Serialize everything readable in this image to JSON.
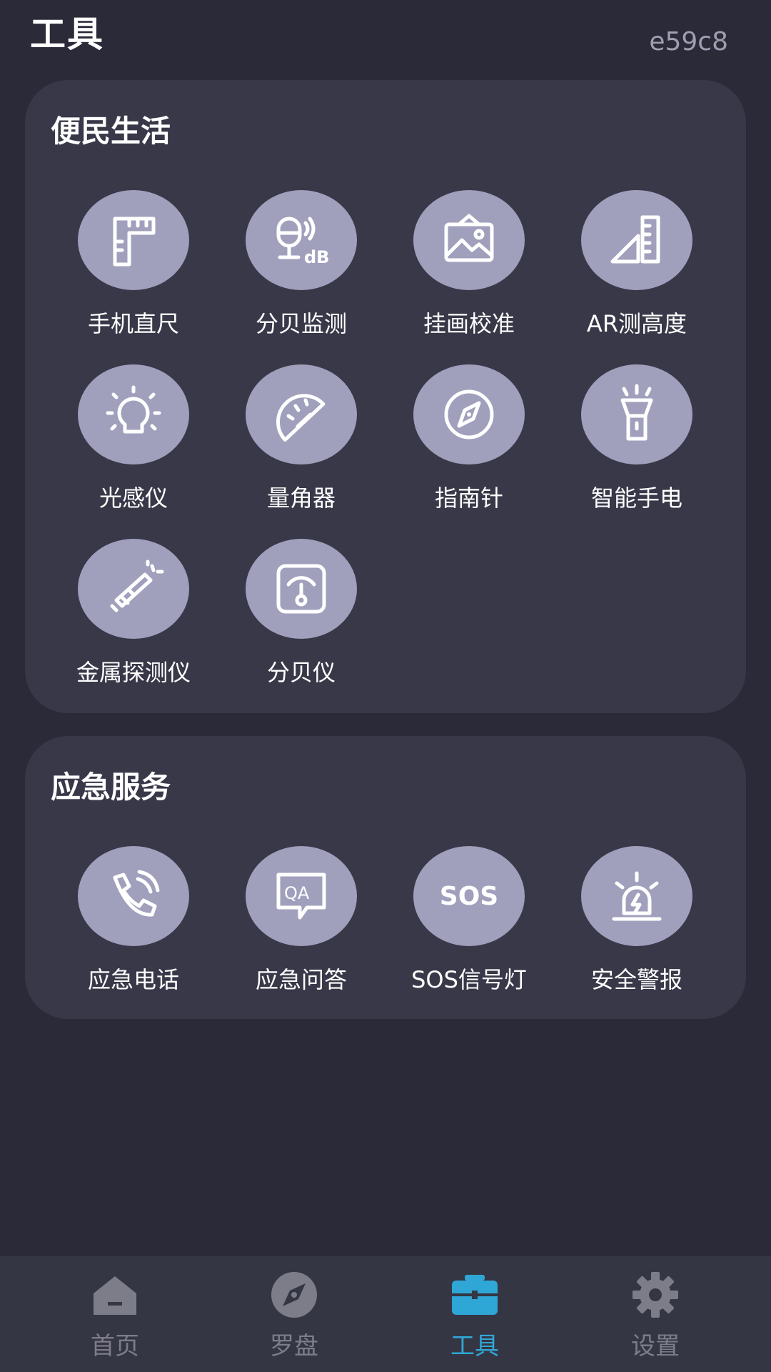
{
  "header": {
    "title": "工具",
    "code": "e59c8"
  },
  "sections": [
    {
      "title": "便民生活",
      "tools": [
        {
          "label": "手机直尺",
          "icon": "ruler-icon"
        },
        {
          "label": "分贝监测",
          "icon": "decibel-monitor-icon"
        },
        {
          "label": "挂画校准",
          "icon": "picture-frame-icon"
        },
        {
          "label": "AR测高度",
          "icon": "height-ruler-icon"
        },
        {
          "label": "光感仪",
          "icon": "light-bulb-icon"
        },
        {
          "label": "量角器",
          "icon": "protractor-icon"
        },
        {
          "label": "指南针",
          "icon": "compass-icon"
        },
        {
          "label": "智能手电",
          "icon": "flashlight-icon"
        },
        {
          "label": "金属探测仪",
          "icon": "metal-detector-icon"
        },
        {
          "label": "分贝仪",
          "icon": "sound-meter-icon"
        }
      ]
    },
    {
      "title": "应急服务",
      "tools": [
        {
          "label": "应急电话",
          "icon": "phone-call-icon"
        },
        {
          "label": "应急问答",
          "icon": "qa-bubble-icon"
        },
        {
          "label": "SOS信号灯",
          "icon": "sos-icon",
          "icon_text": "SOS"
        },
        {
          "label": "安全警报",
          "icon": "alarm-siren-icon"
        }
      ]
    }
  ],
  "nav": {
    "items": [
      {
        "label": "首页",
        "icon": "home-icon",
        "active": false
      },
      {
        "label": "罗盘",
        "icon": "compass-icon",
        "active": false
      },
      {
        "label": "工具",
        "icon": "toolbox-icon",
        "active": true
      },
      {
        "label": "设置",
        "icon": "gear-icon",
        "active": false
      }
    ]
  },
  "colors": {
    "background": "#2b2a39",
    "card": "#383849",
    "icon_circle": "#a0a0bd",
    "nav_bg": "#353644",
    "nav_inactive": "#7d7d8a",
    "nav_active": "#2fa7d6"
  }
}
